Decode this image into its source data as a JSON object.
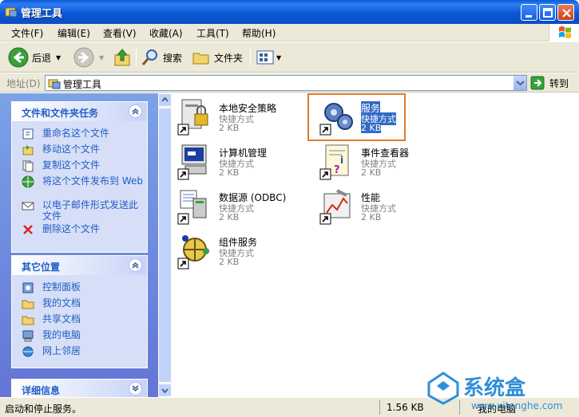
{
  "window": {
    "title": "管理工具"
  },
  "menu": [
    "文件(F)",
    "编辑(E)",
    "查看(V)",
    "收藏(A)",
    "工具(T)",
    "帮助(H)"
  ],
  "toolbar": {
    "back": "后退",
    "search": "搜索",
    "folders": "文件夹"
  },
  "address": {
    "label": "地址(D)",
    "value": "管理工具",
    "go": "转到"
  },
  "left_pane": {
    "tasks": {
      "title": "文件和文件夹任务",
      "items": [
        "重命名这个文件",
        "移动这个文件",
        "复制这个文件",
        "将这个文件发布到 Web",
        "以电子邮件形式发送此文件",
        "删除这个文件"
      ]
    },
    "places": {
      "title": "其它位置",
      "items": [
        "控制面板",
        "我的文档",
        "共享文档",
        "我的电脑",
        "网上邻居"
      ]
    },
    "details": {
      "title": "详细信息"
    }
  },
  "files": [
    {
      "name": "本地安全策略",
      "type": "快捷方式",
      "size": "2 KB",
      "icon": "security-policy-icon"
    },
    {
      "name": "服务",
      "type": "快捷方式",
      "size": "2 KB",
      "icon": "services-gears-icon"
    },
    {
      "name": "计算机管理",
      "type": "快捷方式",
      "size": "2 KB",
      "icon": "computer-management-icon"
    },
    {
      "name": "事件查看器",
      "type": "快捷方式",
      "size": "2 KB",
      "icon": "event-viewer-icon"
    },
    {
      "name": "数据源 (ODBC)",
      "type": "快捷方式",
      "size": "2 KB",
      "icon": "odbc-icon"
    },
    {
      "name": "性能",
      "type": "快捷方式",
      "size": "2 KB",
      "icon": "performance-icon"
    },
    {
      "name": "组件服务",
      "type": "快捷方式",
      "size": "2 KB",
      "icon": "component-services-icon"
    }
  ],
  "status": {
    "text": "启动和停止服务。",
    "size": "1.56 KB",
    "location": "我的电脑"
  },
  "watermark": {
    "text": "系统盒",
    "url": "www.xitonghe.com"
  },
  "colors": {
    "titlebar": "#0a5bd6",
    "task_link": "#215dc6",
    "selection": "#316ac5",
    "highlight_border": "#e07b2a"
  }
}
